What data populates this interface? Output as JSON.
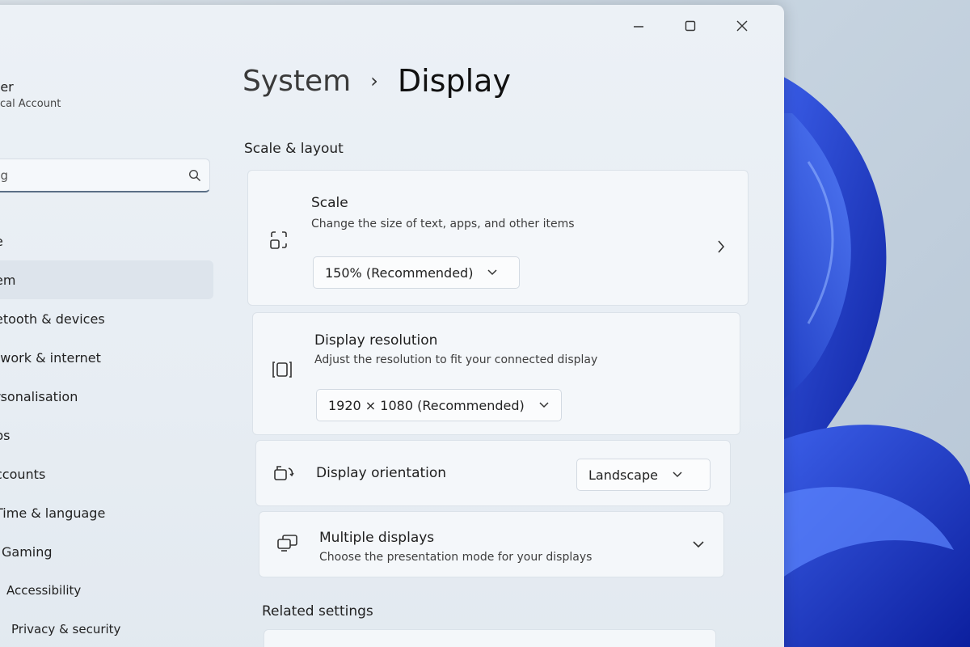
{
  "window": {
    "caption": {
      "minimize": "—",
      "maximize": "□",
      "close": "✕"
    }
  },
  "sidebar": {
    "user": {
      "name": "ser",
      "account": "ocal Account"
    },
    "search": {
      "value": "ng",
      "icon": "search-icon"
    },
    "items": [
      {
        "label": "e",
        "active": false
      },
      {
        "label": "em",
        "active": true
      },
      {
        "label": "etooth & devices",
        "active": false
      },
      {
        "label": "twork & internet",
        "active": false
      },
      {
        "label": "rsonalisation",
        "active": false
      },
      {
        "label": "ps",
        "active": false
      },
      {
        "label": "ccounts",
        "active": false
      },
      {
        "label": "Time & language",
        "active": false
      },
      {
        "label": "Gaming",
        "active": false
      },
      {
        "label": "Accessibility",
        "active": false
      },
      {
        "label": "Privacy & security",
        "active": false
      }
    ]
  },
  "breadcrumb": {
    "parent": "System",
    "separator": "›",
    "current": "Display"
  },
  "sections": {
    "scale_layout": "Scale & layout",
    "related": "Related settings"
  },
  "cards": {
    "scale": {
      "title": "Scale",
      "description": "Change the size of text, apps, and other items",
      "value": "150% (Recommended)",
      "icon": "scale-icon"
    },
    "resolution": {
      "title": "Display resolution",
      "description": "Adjust the resolution to fit your connected display",
      "value": "1920 × 1080 (Recommended)",
      "icon": "resolution-icon"
    },
    "orientation": {
      "title": "Display orientation",
      "value": "Landscape",
      "icon": "orientation-icon"
    },
    "multiple": {
      "title": "Multiple displays",
      "description": "Choose the presentation mode for your displays",
      "icon": "multiple-displays-icon"
    }
  },
  "colors": {
    "wallpaper_blue": "#1f3fd1",
    "active_nav": "#dde4ec",
    "card_bg": "#f4f7fa"
  }
}
